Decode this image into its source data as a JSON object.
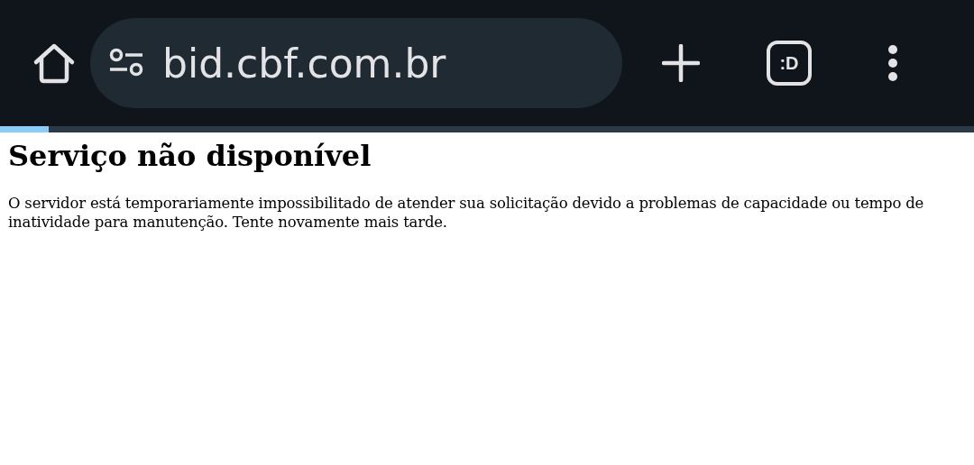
{
  "toolbar": {
    "url": "bid.cbf.com.br",
    "tab_count": ":D"
  },
  "progress": {
    "level": 0.05
  },
  "page": {
    "heading": "Serviço não disponível",
    "message": "O servidor está temporariamente impossibilitado de atender sua solicitação devido a problemas de capacidade ou tempo de inatividade para manutenção. Tente novamente mais tarde."
  }
}
